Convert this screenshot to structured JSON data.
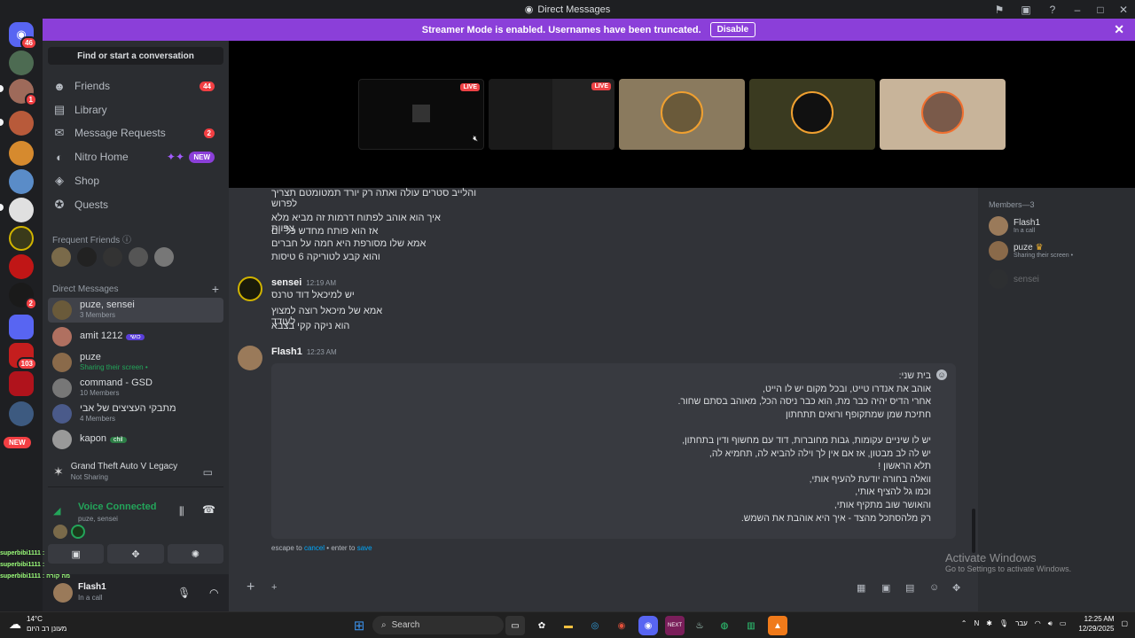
{
  "window": {
    "title": "Direct Messages"
  },
  "streamer_bar": {
    "text": "Streamer Mode is enabled. Usernames have been truncated.",
    "disable_label": "Disable"
  },
  "server_badges": {
    "home": "46",
    "s2": "1",
    "s6": "2",
    "s7": "103",
    "new": "NEW"
  },
  "sidebar": {
    "find_label": "Find or start a conversation",
    "nav": [
      {
        "label": "Friends",
        "count": "44",
        "icon": "friends-icon"
      },
      {
        "label": "Library",
        "icon": "library-icon"
      },
      {
        "label": "Message Requests",
        "count": "2",
        "icon": "mail-icon"
      },
      {
        "label": "Nitro Home",
        "badge": "NEW",
        "icon": "nitro-icon"
      },
      {
        "label": "Shop",
        "icon": "shop-icon"
      },
      {
        "label": "Quests",
        "icon": "quests-icon"
      }
    ],
    "frequent_friends_label": "Frequent Friends",
    "direct_messages_label": "Direct Messages",
    "dms": [
      {
        "name": "puze, sensei",
        "sub": "3 Members"
      },
      {
        "name": "amit 1212",
        "tag": "כושי"
      },
      {
        "name": "puze",
        "sub": "Sharing their screen •"
      },
      {
        "name": "command - GSD",
        "sub": "10 Members"
      },
      {
        "name": "מתבקי העציצים של אבי",
        "sub": "4 Members"
      },
      {
        "name": "kapon",
        "tag": "chil"
      }
    ]
  },
  "activity": {
    "title": "Grand Theft Auto V Legacy",
    "sub": "Not Sharing"
  },
  "voice": {
    "status": "Voice Connected",
    "channel": "puze, sensei"
  },
  "user": {
    "name": "Flash1",
    "status": "In a call"
  },
  "overlay_chat": [
    "superbibi1111 :",
    "superbibi1111 :",
    "superbibi1111 : מה קורה"
  ],
  "stage": {
    "live_label": "LIVE"
  },
  "chat": {
    "top_line": "והלייב סטרים עולה ואתה רק יורד תמטומטם תצריך לפרוש",
    "block1": [
      "איך הוא אוהב לפתוח דרמות זה מביא מלא צפיות",
      "אז הוא פותח מחדש כל יום",
      "אמא שלו מסורפת היא חמה על חברים",
      "והוא קבע לטוריקה 6 טיסות"
    ],
    "msg_sensei": {
      "author": "sensei",
      "time": "12:19 AM",
      "lines": [
        "יש למיכאל דוד טרנס",
        "אמא של מיכאל רוצה למצוץ לעודד",
        "הוא ניקה קקי בצבא"
      ]
    },
    "msg_flash": {
      "author": "Flash1",
      "time": "12:23 AM"
    },
    "edit_lines": [
      "בית שני:",
      "אוהב את אנדרו טייט, ובכל מקום יש לו הייט,",
      "אחרי הדיס יהיה כבר מת, הוא כבר ניסה הכל, מאוהב בסתם שחור.",
      "חתיכת שמן שמתקופף ורואים תתחתון",
      "",
      "יש לו שיניים עקומות, גבות מחוברות, דוד עם מחשוף ודין בתחתון,",
      "יש לה לב מבטון, אז אם אין לך וילה להביא לה, תחמיא לה,",
      "תלא הראשון !",
      "וואלה בחורה יודעת להעיף אותי,",
      "וכמו גל להציף אותי,",
      "והאושר שוב מתקיף אותי,",
      "רק מלהסתכל מהצד - איך היא אוהבת את השמש."
    ],
    "escape_prefix": "escape to",
    "escape_cancel": "cancel",
    "escape_mid": "• enter to",
    "escape_save": "save"
  },
  "members": {
    "header": "Members—3",
    "list": [
      {
        "name": "Flash1",
        "sub": "In a call"
      },
      {
        "name": "puze",
        "sub": "Sharing their screen •"
      },
      {
        "name": "sensei",
        "sub": ""
      }
    ]
  },
  "activate": {
    "line1": "Activate Windows",
    "line2": "Go to Settings to activate Windows."
  },
  "taskbar": {
    "temp": "14°C",
    "weather": "מעונן רב היום",
    "search": "Search",
    "lang": "עבר",
    "time": "12:25 AM",
    "date": "12/29/2025"
  }
}
